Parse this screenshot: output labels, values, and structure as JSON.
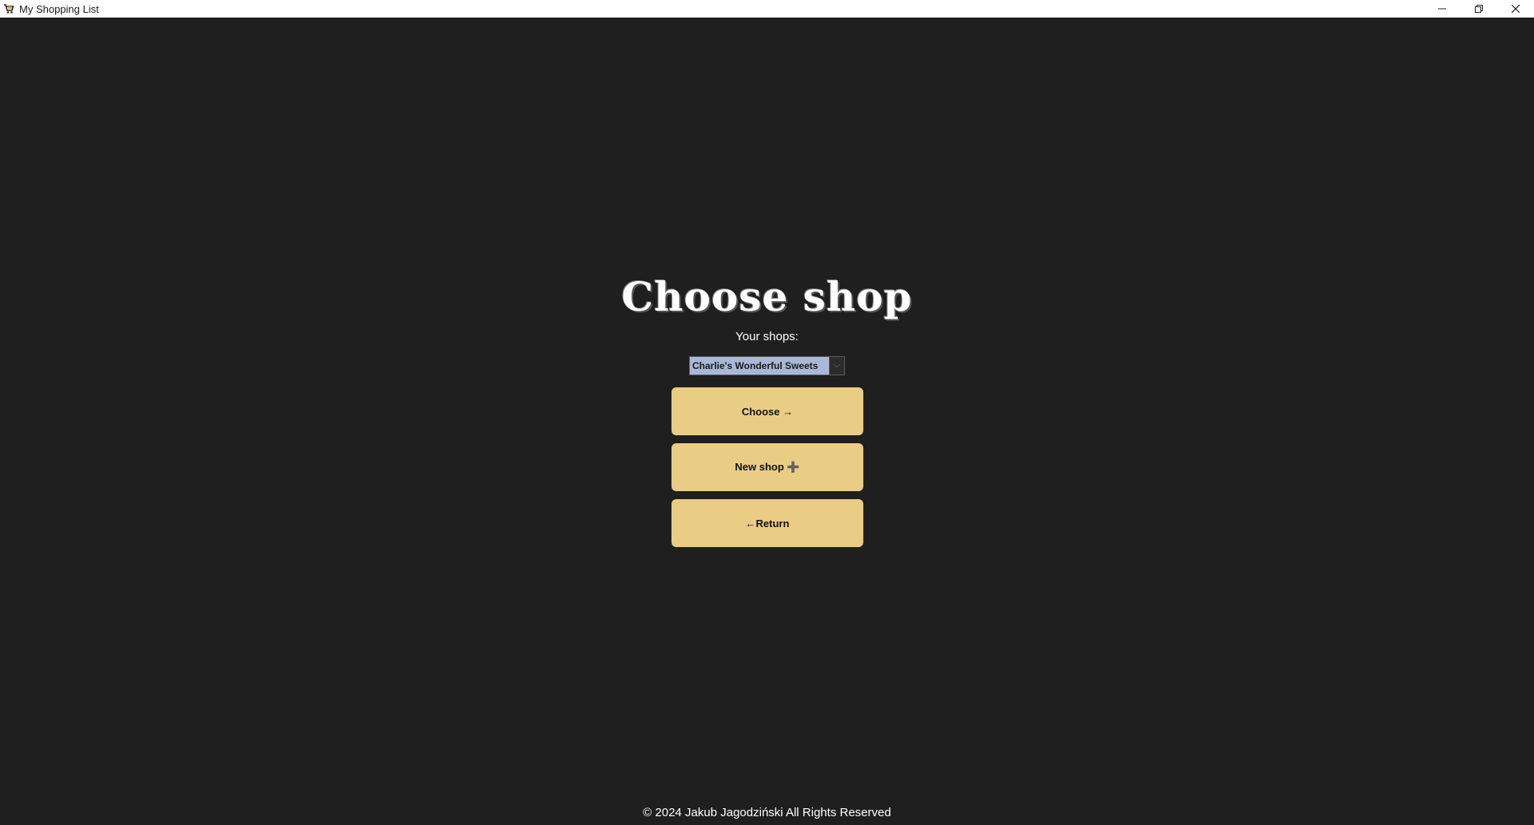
{
  "window": {
    "title": "My Shopping List",
    "controls": {
      "minimize_icon": "minimize-icon",
      "maximize_icon": "restore-icon",
      "close_icon": "close-icon"
    }
  },
  "page": {
    "heading": "Choose shop",
    "shops_label": "Your shops:",
    "shop_select": {
      "selected": "Charlie's Wonderful Sweets"
    },
    "buttons": {
      "choose": "Choose →",
      "new_shop": "New shop ➕",
      "return": "←Return"
    },
    "footer": "© 2024 Jakub Jagodziński All Rights Reserved"
  },
  "colors": {
    "background": "#1f1f1f",
    "button": "#e9cd85",
    "selection_highlight": "#a9b8d6",
    "text": "#ffffff"
  }
}
